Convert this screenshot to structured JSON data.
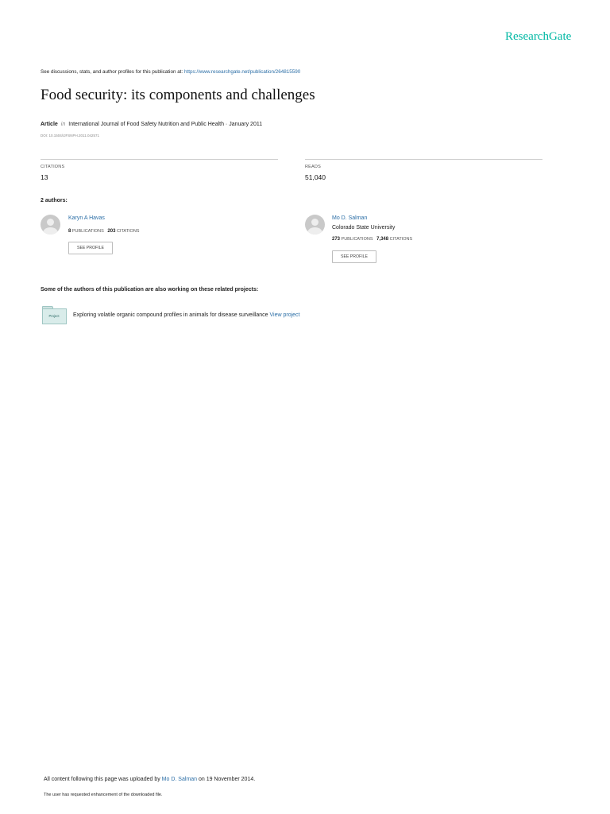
{
  "brand": {
    "logo_text": "ResearchGate",
    "accent_color": "#00b8a4",
    "link_color": "#2b6ea6"
  },
  "header": {
    "discuss_prefix": "See discussions, stats, and author profiles for this publication at: ",
    "publication_url": "https://www.researchgate.net/publication/264815590"
  },
  "article": {
    "title": "Food security: its components and challenges",
    "type": "Article",
    "in_label": "in",
    "journal": "International Journal of Food Safety Nutrition and Public Health · January 2011",
    "doi": "DOI: 10.1504/IJFSNPH.2011.042571"
  },
  "stats": {
    "citations_label": "CITATIONS",
    "citations_value": "13",
    "reads_label": "READS",
    "reads_value": "51,040"
  },
  "authors": {
    "heading": "2 authors:",
    "list": [
      {
        "name": "Karyn A Havas",
        "institution": "",
        "publications": "8",
        "publications_label": "PUBLICATIONS",
        "citations": "203",
        "citations_label": "CITATIONS",
        "button_label": "SEE PROFILE"
      },
      {
        "name": "Mo D. Salman",
        "institution": "Colorado State University",
        "publications": "273",
        "publications_label": "PUBLICATIONS",
        "citations": "7,348",
        "citations_label": "CITATIONS",
        "button_label": "SEE PROFILE"
      }
    ]
  },
  "projects": {
    "heading": "Some of the authors of this publication are also working on these related projects:",
    "items": [
      {
        "icon_label": "Project",
        "text": "Exploring volatile organic compound profiles in animals for disease surveillance",
        "link_label": "View project"
      }
    ]
  },
  "footer": {
    "uploaded_prefix": "All content following this page was uploaded by ",
    "uploader": "Mo D. Salman",
    "uploaded_suffix": " on 19 November 2014.",
    "note": "The user has requested enhancement of the downloaded file."
  }
}
